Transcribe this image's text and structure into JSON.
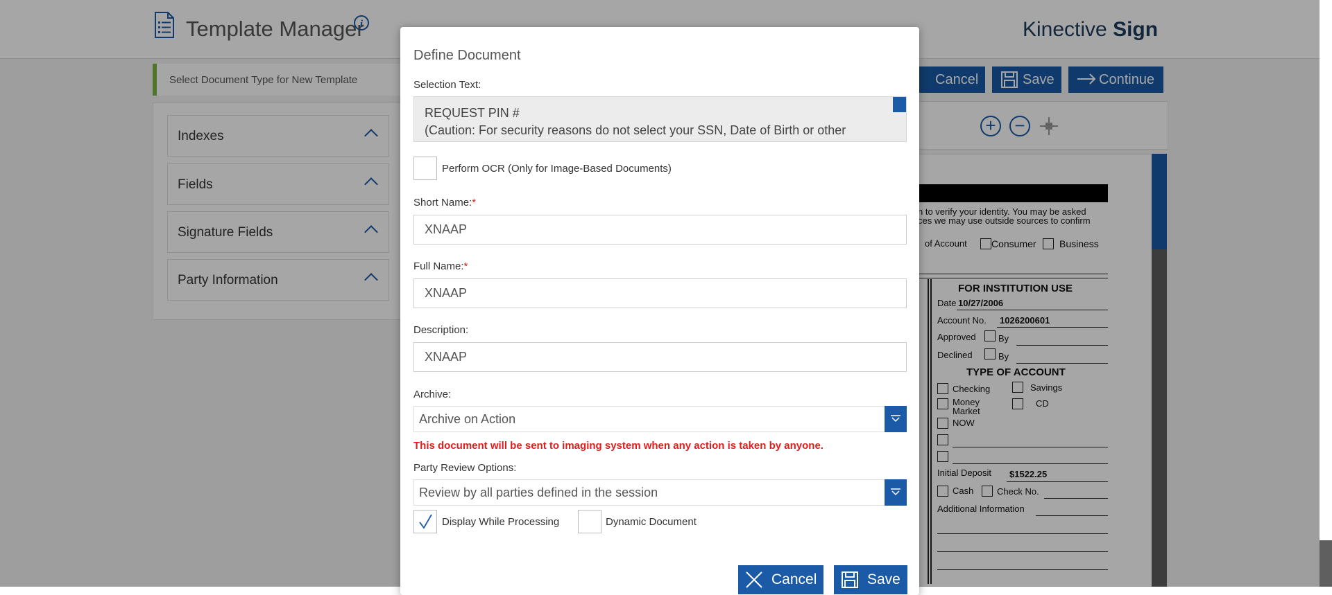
{
  "header": {
    "title": "Template Manager",
    "brand_light": "Kinective",
    "brand_bold": "Sign"
  },
  "select_bar": {
    "label": "Select Document Type for New Template"
  },
  "sidebar": {
    "items": [
      {
        "label": "Indexes"
      },
      {
        "label": "Fields"
      },
      {
        "label": "Signature Fields"
      },
      {
        "label": "Party Information"
      }
    ]
  },
  "toolbar": {
    "cancel_label": "Cancel",
    "save_label": "Save",
    "continue_label": "Continue"
  },
  "document_preview": {
    "line1": "n to verify your identity. You may be asked",
    "line2": "ces we may use outside sources to confirm",
    "of_account": "of Account",
    "consumer": "Consumer",
    "business": "Business",
    "institution_use": "FOR INSTITUTION USE",
    "date_label": "Date",
    "date_value": "10/27/2006",
    "account_no_label": "Account No.",
    "account_no_value": "1026200601",
    "approved": "Approved",
    "declined": "Declined",
    "by1": "By",
    "by2": "By",
    "type_of_account": "TYPE OF ACCOUNT",
    "checking": "Checking",
    "savings": "Savings",
    "money_market_1": "Money",
    "money_market_2": "Market",
    "cd": "CD",
    "now": "NOW",
    "initial_deposit_label": "Initial Deposit",
    "initial_deposit_value": "$1522.25",
    "cash": "Cash",
    "check_no": "Check No.",
    "additional_info": "Additional Information"
  },
  "modal": {
    "title": "Define Document",
    "selection_text_label": "Selection Text:",
    "selection_text_line1": "REQUEST PIN #",
    "selection_text_line2": "(Caution: For security reasons do not select your SSN, Date of Birth or other",
    "ocr_label": "Perform OCR (Only for Image-Based Documents)",
    "ocr_checked": false,
    "short_name_label": "Short Name:",
    "short_name_value": "XNAAP",
    "full_name_label": "Full Name:",
    "full_name_value": "XNAAP",
    "description_label": "Description:",
    "description_value": "XNAAP",
    "required_mark": "*",
    "archive_label": "Archive:",
    "archive_value": "Archive on Action",
    "archive_warning": "This document will be sent to imaging system when any action is taken by anyone.",
    "party_review_label": "Party Review Options:",
    "party_review_value": "Review by all parties defined in the session",
    "display_while_processing_label": "Display While Processing",
    "display_while_processing_checked": true,
    "dynamic_document_label": "Dynamic Document",
    "dynamic_document_checked": false,
    "cancel_label": "Cancel",
    "save_label": "Save"
  },
  "colors": {
    "primary": "#1a5aa6",
    "required": "#e31c1c",
    "accent_green": "#7cb342"
  }
}
